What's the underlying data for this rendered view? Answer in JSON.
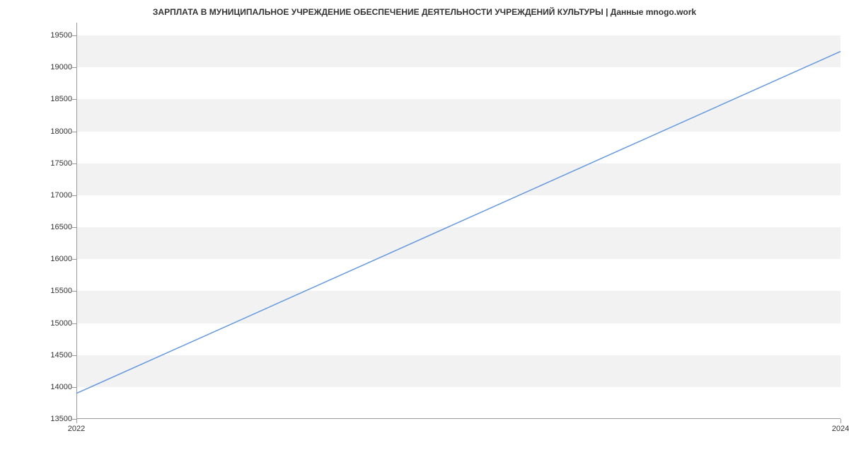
{
  "chart_data": {
    "type": "line",
    "title": "ЗАРПЛАТА В МУНИЦИПАЛЬНОЕ УЧРЕЖДЕНИЕ ОБЕСПЕЧЕНИЕ ДЕЯТЕЛЬНОСТИ УЧРЕЖДЕНИЙ КУЛЬТУРЫ | Данные mnogo.work",
    "x": [
      2022,
      2024
    ],
    "values": [
      13900,
      19250
    ],
    "xlabel": "",
    "ylabel": "",
    "x_ticks": [
      2022,
      2024
    ],
    "y_ticks": [
      13500,
      14000,
      14500,
      15000,
      15500,
      16000,
      16500,
      17000,
      17500,
      18000,
      18500,
      19000,
      19500
    ],
    "ylim": [
      13500,
      19700
    ],
    "xlim": [
      2022,
      2024
    ]
  }
}
